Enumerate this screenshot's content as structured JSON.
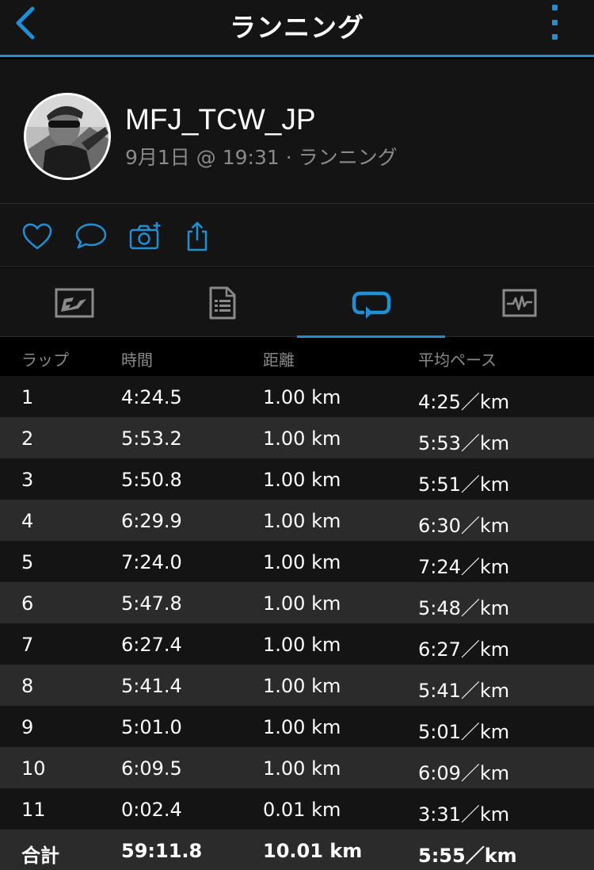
{
  "nav": {
    "title": "ランニング"
  },
  "profile": {
    "username": "MFJ_TCW_JP",
    "meta": "9月1日 @ 19:31 · ランニング"
  },
  "actions": {
    "like_icon": "heart-icon",
    "comment_icon": "speech-bubble-icon",
    "photo_icon": "camera-plus-icon",
    "share_icon": "share-icon"
  },
  "tabs": [
    {
      "icon": "overview-icon",
      "active": false
    },
    {
      "icon": "stats-document-icon",
      "active": false
    },
    {
      "icon": "laps-loop-icon",
      "active": true
    },
    {
      "icon": "charts-icon",
      "active": false
    }
  ],
  "colors": {
    "accent": "#1f8fd6",
    "row_light": "#2b2b2b",
    "row_dark": "#141414"
  },
  "laps": {
    "headers": [
      "ラップ",
      "時間",
      "距離",
      "平均ペース"
    ],
    "rows": [
      [
        "1",
        "4:24.5",
        "1.00 km",
        "4:25／km"
      ],
      [
        "2",
        "5:53.2",
        "1.00 km",
        "5:53／km"
      ],
      [
        "3",
        "5:50.8",
        "1.00 km",
        "5:51／km"
      ],
      [
        "4",
        "6:29.9",
        "1.00 km",
        "6:30／km"
      ],
      [
        "5",
        "7:24.0",
        "1.00 km",
        "7:24／km"
      ],
      [
        "6",
        "5:47.8",
        "1.00 km",
        "5:48／km"
      ],
      [
        "7",
        "6:27.4",
        "1.00 km",
        "6:27／km"
      ],
      [
        "8",
        "5:41.4",
        "1.00 km",
        "5:41／km"
      ],
      [
        "9",
        "5:01.0",
        "1.00 km",
        "5:01／km"
      ],
      [
        "10",
        "6:09.5",
        "1.00 km",
        "6:09／km"
      ],
      [
        "11",
        "0:02.4",
        "0.01 km",
        "3:31／km"
      ]
    ],
    "total": [
      "合計",
      "59:11.8",
      "10.01 km",
      "5:55／km"
    ]
  }
}
